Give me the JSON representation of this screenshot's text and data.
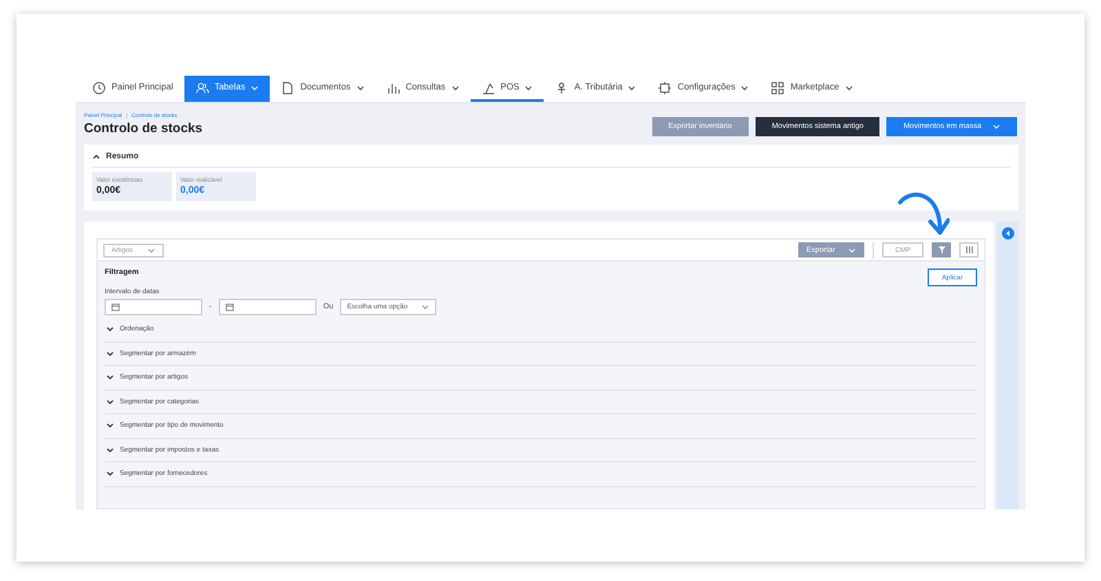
{
  "nav": {
    "tabs": [
      {
        "label": "Painel Principal",
        "dropdown": false,
        "selected": false,
        "current": false
      },
      {
        "label": "Tabelas",
        "dropdown": true,
        "selected": true,
        "current": false
      },
      {
        "label": "Documentos",
        "dropdown": true,
        "selected": false,
        "current": false
      },
      {
        "label": "Consultas",
        "dropdown": true,
        "selected": false,
        "current": false
      },
      {
        "label": "POS",
        "dropdown": true,
        "selected": false,
        "current": true
      },
      {
        "label": "A. Tributária",
        "dropdown": true,
        "selected": false,
        "current": false
      },
      {
        "label": "Configurações",
        "dropdown": true,
        "selected": false,
        "current": false
      },
      {
        "label": "Marketplace",
        "dropdown": true,
        "selected": false,
        "current": false
      }
    ]
  },
  "header": {
    "breadcrumb": [
      "Painel Principal",
      "Controlo de stocks"
    ],
    "breadcrumb_separator": "|",
    "title": "Controlo de stocks",
    "buttons": [
      {
        "label": "Exportar inventário",
        "kind": "muted",
        "dropdown": false
      },
      {
        "label": "Movimentos sistema antigo",
        "kind": "dark",
        "dropdown": false
      },
      {
        "label": "Movimentos em massa",
        "kind": "primary",
        "dropdown": true
      }
    ]
  },
  "summary": {
    "title": "Resumo",
    "expanded": true,
    "cards": [
      {
        "label": "Valor existências",
        "value": "0,00€",
        "highlight": false
      },
      {
        "label": "Valor realizável",
        "value": "0,00€",
        "highlight": true
      }
    ]
  },
  "toolbar": {
    "view_select": "Artigos",
    "export": "Exportar",
    "cmp": "CMP",
    "filter_active": true
  },
  "filter": {
    "title": "Filtragem",
    "apply": "Aplicar",
    "date_label": "Intervalo de datas",
    "separator": "-",
    "or": "Ou",
    "option_placeholder": "Escolha uma opção",
    "sections": [
      {
        "label": "Ordenação",
        "expanded": false
      },
      {
        "label": "Segmentar por armazém",
        "expanded": false
      },
      {
        "label": "Segmentar por artigos",
        "expanded": false
      },
      {
        "label": "Segmentar por categorias",
        "expanded": false
      },
      {
        "label": "Segmentar por tipo de movimento",
        "expanded": false
      },
      {
        "label": "Segmentar por impostos e taxas",
        "expanded": false
      },
      {
        "label": "Segmentar por fornecedores",
        "expanded": false
      }
    ]
  }
}
